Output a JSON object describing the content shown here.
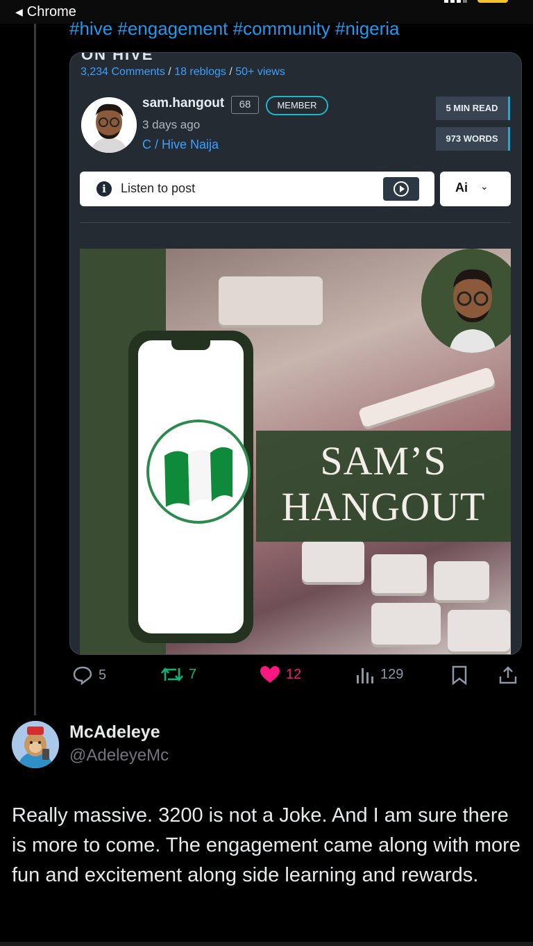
{
  "status_bar": {
    "back_label": "Chrome"
  },
  "post": {
    "hashtags": "#hive #engagement #community #nigeria",
    "cut_title": "ON HIVE",
    "card": {
      "stats": {
        "comments": "3,234 Comments",
        "sep1": " / ",
        "reblogs": "18 reblogs",
        "sep2": " / ",
        "views": "50+ views"
      },
      "author": "sam.hangout",
      "reputation": "68",
      "badge": "MEMBER",
      "time_ago": "3 days ago",
      "community": "C / Hive Naija",
      "read_time": "5 MIN READ",
      "word_count": "973 WORDS",
      "listen_label": "Listen to post",
      "ai_label": "Ai",
      "image": {
        "line1": "SAM’S",
        "line2": "HANGOUT"
      }
    },
    "actions": {
      "replies": "5",
      "reposts": "7",
      "likes": "12",
      "views": "129"
    },
    "colors": {
      "link": "#1d9bf0",
      "like": "#f91880",
      "repost": "#00ba7c",
      "accent": "#20b7c9"
    }
  },
  "reply": {
    "name": "McAdeleye",
    "handle": "@AdeleyeMc",
    "text": "Really massive. 3200 is not a Joke. And I am sure there is more to come. The engagement came along with more fun and excitement along side learning and rewards."
  }
}
